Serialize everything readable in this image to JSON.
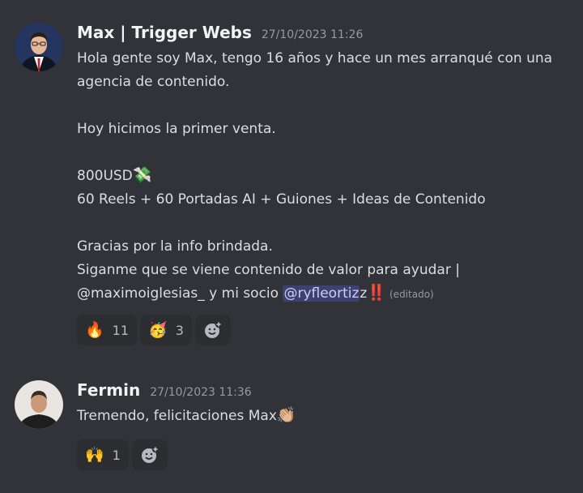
{
  "messages": [
    {
      "author": "Max | Trigger Webs",
      "timestamp": "27/10/2023 11:26",
      "lines": [
        "Hola gente soy Max, tengo 16 años y hace un mes arranqué con una",
        "agencia de contenido.",
        "",
        "Hoy hicimos la primer venta.",
        "",
        "800USD",
        "60 Reels + 60 Portadas AI + Guiones + Ideas de Contenido",
        "",
        "Gracias por la info brindada.",
        "Siganme que se viene contenido de valor para ayudar |"
      ],
      "last_line_prefix": "@maximoiglesias_ y mi socio ",
      "mention": "@ryfleortiz",
      "last_line_suffix": "z",
      "edited": "(editado)",
      "money_emoji": "💸",
      "exclaim_emoji": "‼️",
      "reactions": [
        {
          "emoji": "🔥",
          "count": "11"
        },
        {
          "emoji": "🥳",
          "count": "3"
        }
      ]
    },
    {
      "author": "Fermin",
      "timestamp": "27/10/2023 11:36",
      "text": "Tremendo, felicitaciones Max",
      "clap_emoji": "👏🏼",
      "reactions": [
        {
          "emoji": "🙌",
          "count": "1"
        }
      ]
    }
  ],
  "icons": {
    "add_reaction": "add-reaction-icon"
  }
}
